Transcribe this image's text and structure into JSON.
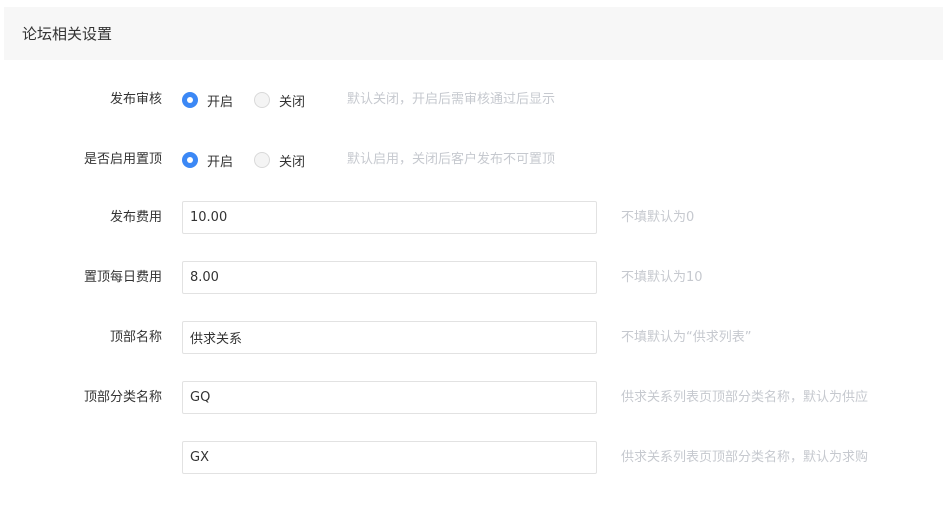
{
  "panel": {
    "title": "论坛相关设置"
  },
  "review": {
    "label": "发布审核",
    "on_label": "开启",
    "off_label": "关闭",
    "hint": "默认关闭，开启后需审核通过后显示"
  },
  "pin_enable": {
    "label": "是否启用置顶",
    "on_label": "开启",
    "off_label": "关闭",
    "hint": "默认启用，关闭后客户发布不可置顶"
  },
  "publish_fee": {
    "label": "发布费用",
    "value": "10.00",
    "hint": "不填默认为0"
  },
  "pin_daily_fee": {
    "label": "置顶每日费用",
    "value": "8.00",
    "hint": "不填默认为10"
  },
  "top_name": {
    "label": "顶部名称",
    "value": "供求关系",
    "hint": "不填默认为“供求列表”"
  },
  "top_category": {
    "label": "顶部分类名称",
    "supply_value": "GQ",
    "supply_hint": "供求关系列表页顶部分类名称，默认为供应",
    "demand_value": "GX",
    "demand_hint": "供求关系列表页顶部分类名称，默认为求购"
  }
}
